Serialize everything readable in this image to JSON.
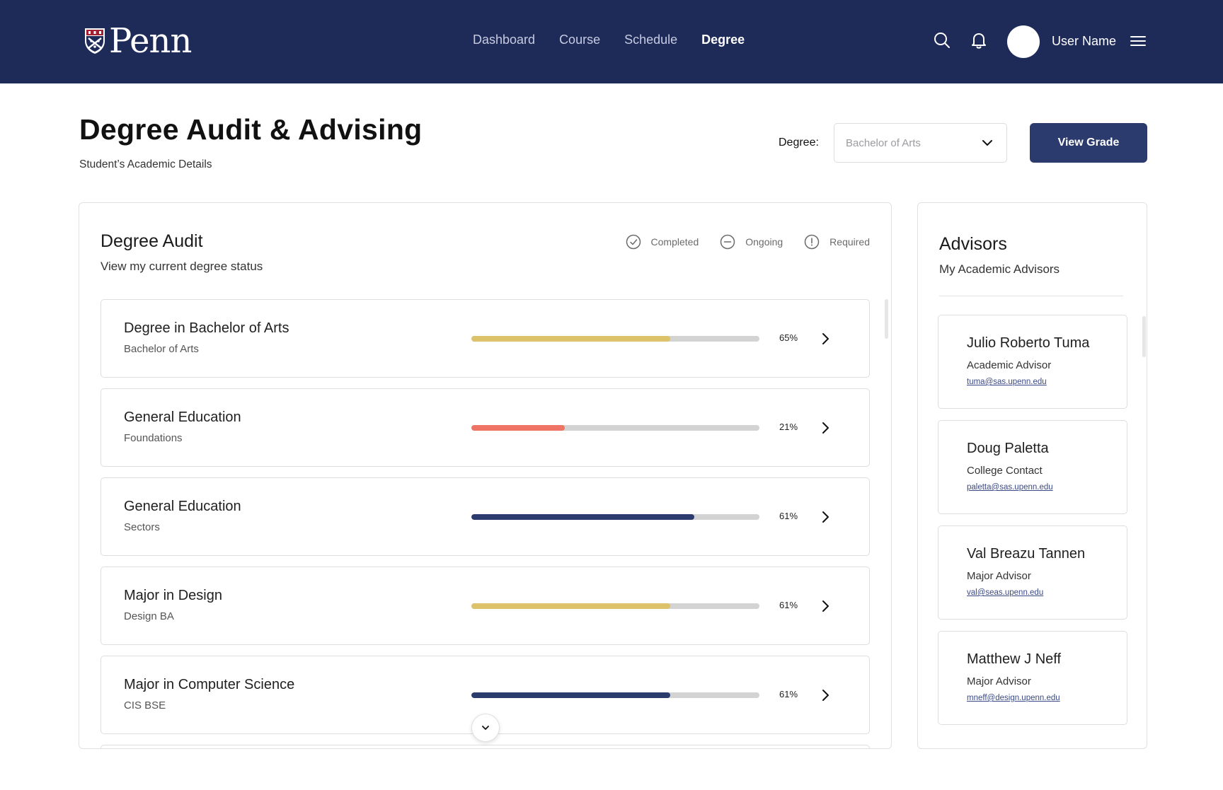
{
  "header": {
    "logo_text": "Penn",
    "nav": [
      {
        "label": "Dashboard",
        "active": false
      },
      {
        "label": "Course",
        "active": false
      },
      {
        "label": "Schedule",
        "active": false
      },
      {
        "label": "Degree",
        "active": true
      }
    ],
    "icons": [
      "search-icon",
      "bell-icon",
      "menu-icon"
    ],
    "user_name": "User Name"
  },
  "page": {
    "title": "Degree Audit & Advising",
    "subtitle": "Student’s Academic Details",
    "degree_label": "Degree:",
    "degree_select_placeholder": "Bachelor of Arts",
    "view_grade_label": "View Grade"
  },
  "audit": {
    "title": "Degree Audit",
    "subtitle": "View my current degree status",
    "legend": [
      {
        "label": "Completed",
        "icon": "check-circle-icon"
      },
      {
        "label": "Ongoing",
        "icon": "minus-circle-icon"
      },
      {
        "label": "Required",
        "icon": "exclamation-circle-icon"
      }
    ],
    "rows": [
      {
        "title": "Degree in Bachelor of Arts",
        "subtitle": "Bachelor of Arts",
        "percent_label": "65%",
        "fill_fraction": 0.69,
        "color": "#dcc36a"
      },
      {
        "title": "General Education",
        "subtitle": "Foundations",
        "percent_label": "21%",
        "fill_fraction": 0.325,
        "color": "#f07466"
      },
      {
        "title": "General Education",
        "subtitle": "Sectors",
        "percent_label": "61%",
        "fill_fraction": 0.775,
        "color": "#2b3b6d"
      },
      {
        "title": "Major in Design",
        "subtitle": "Design BA",
        "percent_label": "61%",
        "fill_fraction": 0.69,
        "color": "#dcc36a"
      },
      {
        "title": "Major in Computer Science",
        "subtitle": "CIS BSE",
        "percent_label": "61%",
        "fill_fraction": 0.69,
        "color": "#2b3b6d"
      }
    ]
  },
  "advisors": {
    "title": "Advisors",
    "subtitle": "My Academic Advisors",
    "items": [
      {
        "name": "Julio Roberto Tuma",
        "role": "Academic Advisor",
        "email": "tuma@sas.upenn.edu"
      },
      {
        "name": "Doug Paletta",
        "role": "College Contact",
        "email": "paletta@sas.upenn.edu"
      },
      {
        "name": "Val Breazu Tannen",
        "role": "Major Advisor",
        "email": "val@seas.upenn.edu"
      },
      {
        "name": "Matthew J Neff",
        "role": "Major Advisor",
        "email": "mneff@design.upenn.edu"
      }
    ]
  },
  "colors": {
    "header_bg": "#1e2b59",
    "primary_button": "#2b3b6d",
    "gold": "#dcc36a",
    "coral": "#f07466",
    "navy": "#2b3b6d"
  }
}
